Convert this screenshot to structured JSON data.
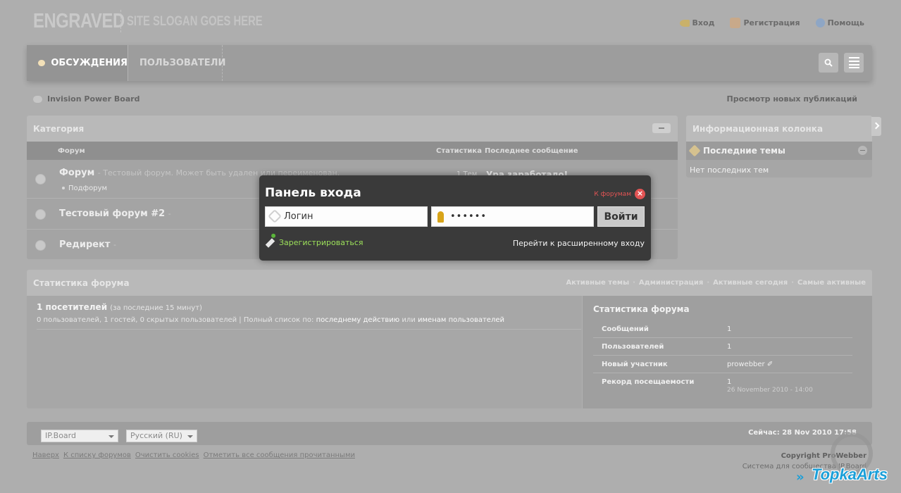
{
  "header": {
    "logo": "ENGRAVED",
    "slogan": "SITE SLOGAN GOES HERE",
    "links": [
      "Вход",
      "Регистрация",
      "Помощь"
    ]
  },
  "nav": {
    "tabs": [
      "ОБСУЖДЕНИЯ",
      "ПОЛЬЗОВАТЕЛИ"
    ]
  },
  "breadcrumb": "Invision Power Board",
  "new_posts": "Просмотр новых публикаций",
  "category": {
    "title": "Категория",
    "columns": [
      "Форум",
      "Статистика",
      "Последнее сообщение"
    ],
    "forums": [
      {
        "name": "Форум",
        "desc": "- Тестовый форум. Может быть удален или переименован.",
        "subforum": "Подфорум",
        "topics": "1 Тем",
        "last": "Ура заработало!"
      },
      {
        "name": "Тестовый форум #2",
        "desc": "-"
      },
      {
        "name": "Редирект",
        "desc": "-"
      }
    ]
  },
  "sidebar": {
    "title": "Информационная колонка",
    "sub": "Последние темы",
    "empty": "Нет последних тем"
  },
  "stats": {
    "title": "Статистика форума",
    "links": [
      "Активные темы",
      "Администрация",
      "Активные сегодня",
      "Самые активные"
    ],
    "online_title": "1 посетителей",
    "online_period": "(за последние 15 минут)",
    "online_desc": "0 пользователей, 1 гостей, 0 скрытых пользователей | Полный список по:",
    "online_link1": "последнему действию",
    "online_or": "или",
    "online_link2": "именам пользователей",
    "right_title": "Статистика форума",
    "rows": [
      {
        "label": "Сообщений",
        "value": "1"
      },
      {
        "label": "Пользователей",
        "value": "1"
      },
      {
        "label": "Новый участник",
        "value": "prowebber ✐"
      },
      {
        "label": "Рекорд посещаемости",
        "value": "1",
        "sub": "26 November 2010 - 14:00"
      }
    ]
  },
  "footer": {
    "skin_select": "IP.Board",
    "lang_select": "Русский (RU)",
    "time": "Сейчас: 28 Nov 2010 17:58",
    "links": [
      "Наверх",
      "К списку форумов",
      "Очистить cookies",
      "Отметить все сообщения прочитанными"
    ],
    "copyright1": "Copyright ProWebber",
    "copyright2": "Система для сообщества IP.Board"
  },
  "login": {
    "title": "Панель входа",
    "back": "К форумам",
    "username": "Логин",
    "password": "••••••",
    "submit": "Войти",
    "register": "Зарегистрироваться",
    "advanced": "Перейти к расширенному входу"
  },
  "watermark": {
    "text": "TopkaArts"
  }
}
